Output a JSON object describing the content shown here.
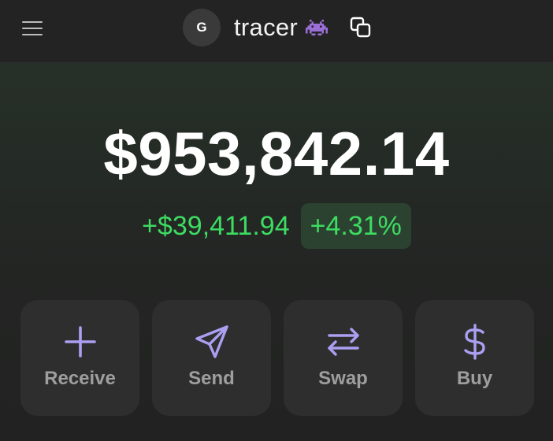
{
  "header": {
    "avatar_initial": "G",
    "account_name": "tracer",
    "account_emoji": "alien-monster-icon",
    "menu_icon": "hamburger-menu-icon",
    "copy_icon": "copy-icon"
  },
  "portfolio": {
    "balance": "$953,842.14",
    "change_amount": "+$39,411.94",
    "change_percent": "+4.31%"
  },
  "actions": [
    {
      "label": "Receive",
      "icon": "plus-icon"
    },
    {
      "label": "Send",
      "icon": "send-icon"
    },
    {
      "label": "Swap",
      "icon": "swap-arrows-icon"
    },
    {
      "label": "Buy",
      "icon": "dollar-icon"
    }
  ],
  "colors": {
    "background": "#232323",
    "positive": "#3ddc62",
    "positive_bg": "#2b4230",
    "accent": "#ab9ff2",
    "button_bg": "#2e2e2e",
    "button_text": "#9e9e9e"
  }
}
